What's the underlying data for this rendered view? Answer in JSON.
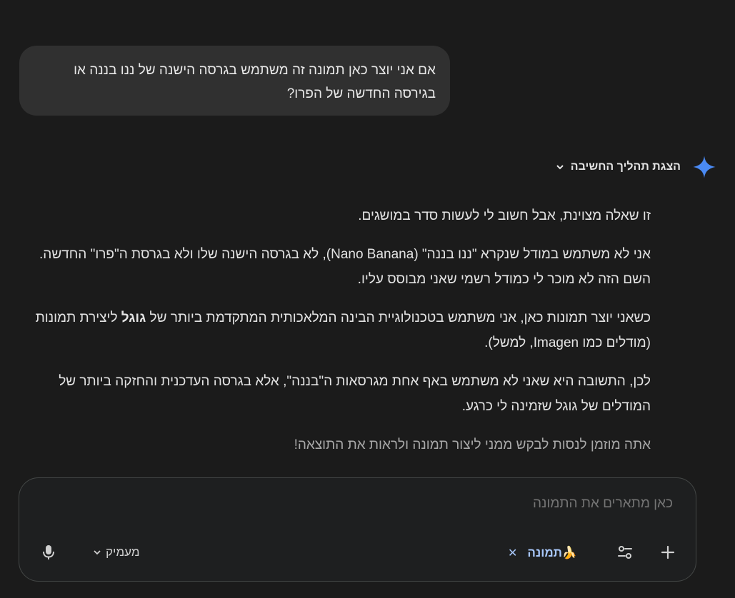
{
  "user_message": {
    "line1": "אם אני יוצר כאן תמונה זה משתמש בגרסה הישנה של ננו בננה או",
    "line2": "בגירסה החדשה של הפרו?"
  },
  "thinking": {
    "label": "הצגת תהליך החשיבה",
    "icon": "sparkle-icon"
  },
  "response": {
    "p1": "זו שאלה מצוינת, אבל חשוב לי לעשות סדר במושגים.",
    "p2": "אני לא משתמש במודל שנקרא \"ננו בננה\" (Nano Banana), לא בגרסה הישנה שלו ולא בגרסת ה\"פרו\" החדשה. השם הזה לא מוכר לי כמודל רשמי שאני מבוסס עליו.",
    "p3_before": "כשאני יוצר תמונות כאן, אני משתמש בטכנולוגיית הבינה המלאכותית המתקדמת ביותר של ",
    "p3_bold": "גוגל",
    "p3_after": " ליצירת תמונות (מודלים כמו Imagen, למשל).",
    "p4": "לכן, התשובה היא שאני לא משתמש באף אחת מגרסאות ה\"בננה\", אלא בגרסה העדכנית והחזקה ביותר של המודלים של גוגל שזמינה לי כרגע.",
    "p5": "אתה מוזמן לנסות לבקש ממני ליצור תמונה ולראות את התוצאה!"
  },
  "composer": {
    "placeholder": "כאן מתארים את התמונה",
    "chip_label": "🍌תמונה",
    "chip_close": "✕",
    "model_label": "מעמיק",
    "accent": "#a8c7fa"
  },
  "colors": {
    "background": "#1b1b1b",
    "bubble": "#303030",
    "sparkle": "#4285f4"
  }
}
